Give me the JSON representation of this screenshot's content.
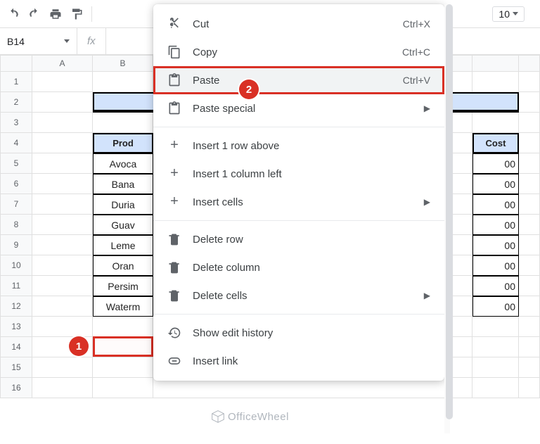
{
  "toolbar": {
    "font_size": "10"
  },
  "namebox": {
    "cell_ref": "B14"
  },
  "columns": [
    "A",
    "B",
    "",
    "",
    ""
  ],
  "col_b_label": "B",
  "grid": {
    "rows": [
      1,
      2,
      3,
      4,
      5,
      6,
      7,
      8,
      9,
      10,
      11,
      12,
      13,
      14,
      15,
      16
    ],
    "header_product": "Prod",
    "header_cost_suffix": "Cost",
    "products": [
      "Avoca",
      "Bana",
      "Duria",
      "Guav",
      "Leme",
      "Oran",
      "Persim",
      "Waterm"
    ],
    "cost_suffix": [
      "00",
      "00",
      "00",
      "00",
      "00",
      "00",
      "00",
      "00"
    ]
  },
  "menu": {
    "cut": "Cut",
    "cut_k": "Ctrl+X",
    "copy": "Copy",
    "copy_k": "Ctrl+C",
    "paste": "Paste",
    "paste_k": "Ctrl+V",
    "paste_special": "Paste special",
    "ins_row": "Insert 1 row above",
    "ins_col": "Insert 1 column left",
    "ins_cells": "Insert cells",
    "del_row": "Delete row",
    "del_col": "Delete column",
    "del_cells": "Delete cells",
    "history": "Show edit history",
    "link": "Insert link"
  },
  "annotations": {
    "one": "1",
    "two": "2"
  },
  "watermark": "OfficeWheel"
}
